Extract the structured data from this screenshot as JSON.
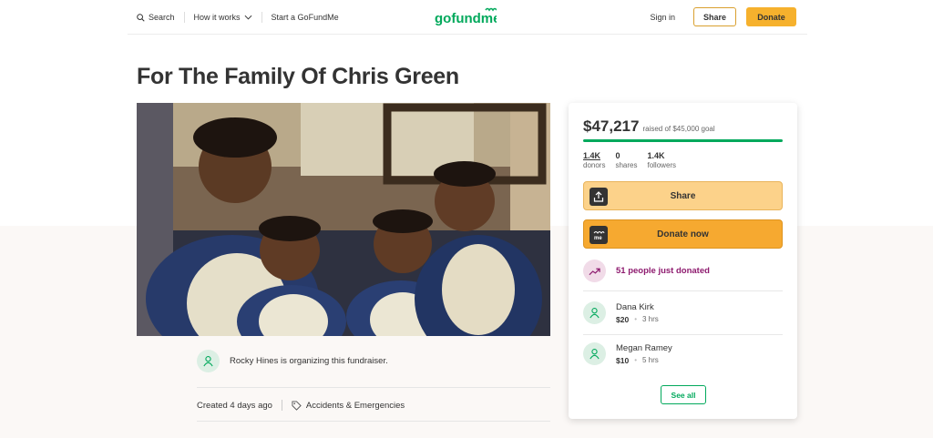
{
  "header": {
    "search_label": "Search",
    "how_it_works_label": "How it works",
    "start_label": "Start a GoFundMe",
    "logo_text": "gofundme",
    "signin_label": "Sign in",
    "share_label": "Share",
    "donate_label": "Donate",
    "brand_color": "#02a95c",
    "donate_color": "#f6b12d"
  },
  "campaign": {
    "title": "For The Family Of Chris Green",
    "organizer_text": "Rocky Hines is organizing this fundraiser.",
    "created_text": "Created 4 days ago",
    "category": "Accidents & Emergencies"
  },
  "card": {
    "amount": "$47,217",
    "goal_text": "raised of $45,000 goal",
    "progress": 1.0,
    "stats": [
      {
        "value": "1.4K",
        "label": "donors"
      },
      {
        "value": "0",
        "label": "shares"
      },
      {
        "value": "1.4K",
        "label": "followers"
      }
    ],
    "share_button": "Share",
    "donate_button": "Donate now",
    "recent_text": "51 people just donated",
    "donors": [
      {
        "name": "Dana Kirk",
        "amount": "$20",
        "time": "3 hrs"
      },
      {
        "name": "Megan Ramey",
        "amount": "$10",
        "time": "5 hrs"
      }
    ],
    "see_all": "See all"
  }
}
